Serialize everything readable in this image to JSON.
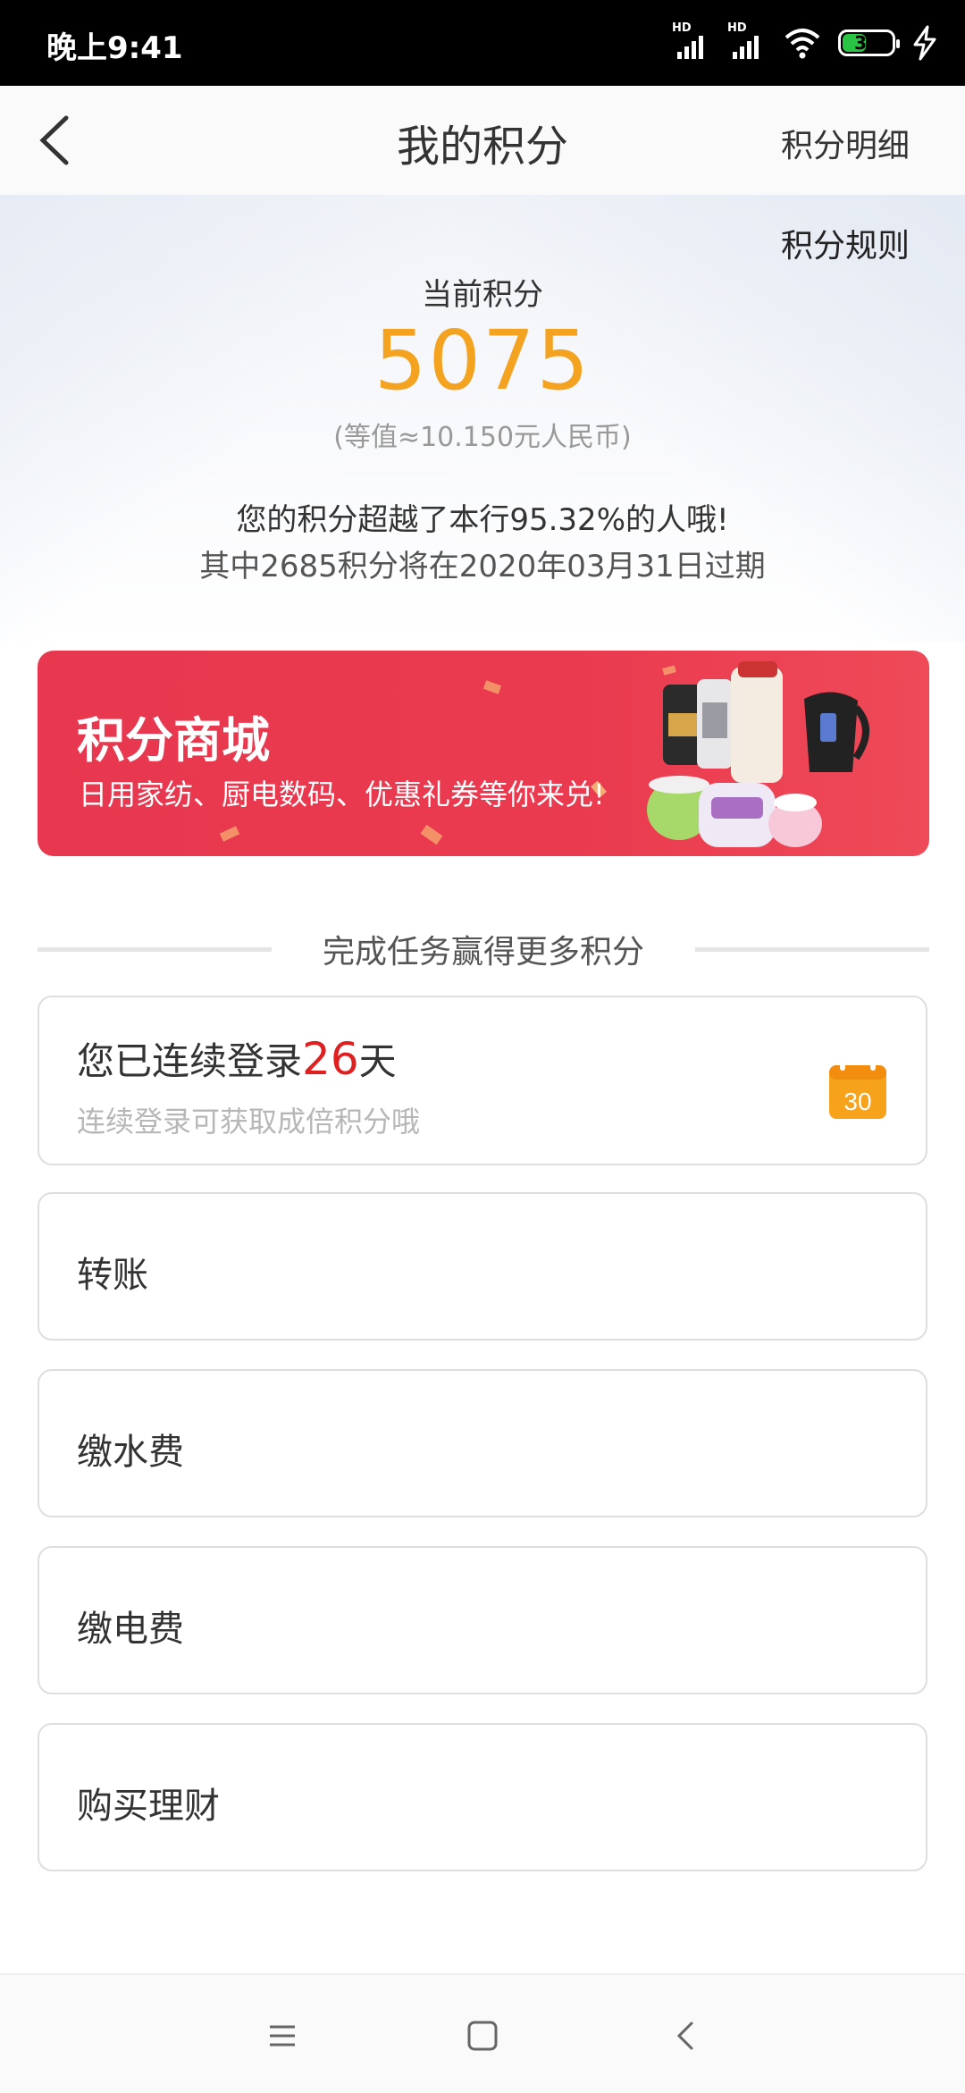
{
  "status_bar": {
    "time": "晚上9:41",
    "network1": "HD",
    "network2": "HD",
    "battery": "34"
  },
  "header": {
    "title": "我的积分",
    "detail_link": "积分明细"
  },
  "hero": {
    "rules_link": "积分规则",
    "current_label": "当前积分",
    "points": "5075",
    "equivalent": "(等值≈10.150元人民币)",
    "rank_text": "您的积分超越了本行95.32%的人哦!",
    "expire_text": "其中2685积分将在2020年03月31日过期"
  },
  "banner": {
    "title": "积分商城",
    "subtitle": "日用家纺、厨电数码、优惠礼券等你来兑!"
  },
  "tasks": {
    "section_title": "完成任务赢得更多积分",
    "login": {
      "prefix": "您已连续登录",
      "days": "26",
      "suffix": "天",
      "hint": "连续登录可获取成倍积分哦",
      "calendar_number": "30"
    },
    "items": [
      {
        "label": "转账"
      },
      {
        "label": "缴水费"
      },
      {
        "label": "缴电费"
      },
      {
        "label": "购买理财"
      }
    ]
  },
  "colors": {
    "points": "#f4a321",
    "banner": "#e8384f",
    "days": "#e02020",
    "calendar": "#f7a21b"
  },
  "icons": [
    "back-arrow-icon",
    "calendar-icon",
    "menu-icon",
    "home-icon",
    "nav-back-icon"
  ]
}
